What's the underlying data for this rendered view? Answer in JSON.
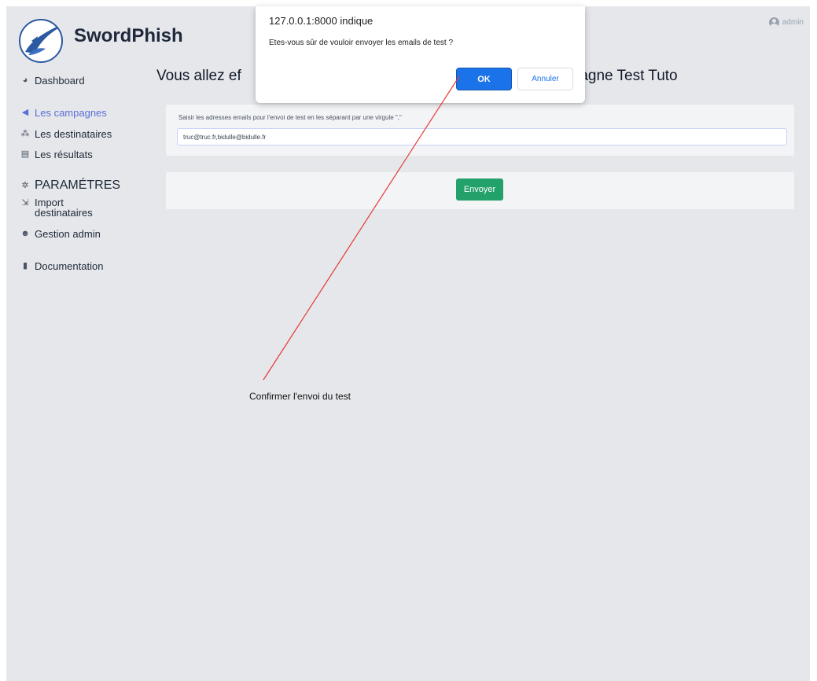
{
  "brand": {
    "name": "SwordPhish"
  },
  "user": {
    "name": "admin"
  },
  "sidebar": {
    "items": [
      {
        "label": "Dashboard",
        "icon": "palette-icon"
      },
      {
        "label": "Les campagnes",
        "icon": "paper-plane-icon"
      },
      {
        "label": "Les destinataires",
        "icon": "users-icon"
      },
      {
        "label": "Les résultats",
        "icon": "list-icon"
      },
      {
        "label": "PARAMÉTRES",
        "icon": "gear-icon"
      },
      {
        "label": "Import destinataires",
        "icon": "file-import-icon"
      },
      {
        "label": "Gestion admin",
        "icon": "user-gear-icon"
      },
      {
        "label": "Documentation",
        "icon": "file-icon"
      }
    ]
  },
  "main": {
    "title_left": "Vous allez ef",
    "title_right": "pagne Test Tuto",
    "email_label": "Saisir les adresses emails pour l'envoi de test en les séparant par une virgule \",\"",
    "email_value": "truc@truc.fr,bidulle@bidulle.fr",
    "send_label": "Envoyer"
  },
  "dialog": {
    "origin": "127.0.0.1:8000 indique",
    "message": "Etes-vous sûr de vouloir envoyer les emails de test ?",
    "ok_label": "OK",
    "cancel_label": "Annuler"
  },
  "annotation": {
    "text": "Confirmer l'envoi du test"
  },
  "colors": {
    "accent": "#5b6fd6",
    "send_button": "#22a16b",
    "dialog_ok": "#1a73e8",
    "annotation_line": "#e53935"
  }
}
